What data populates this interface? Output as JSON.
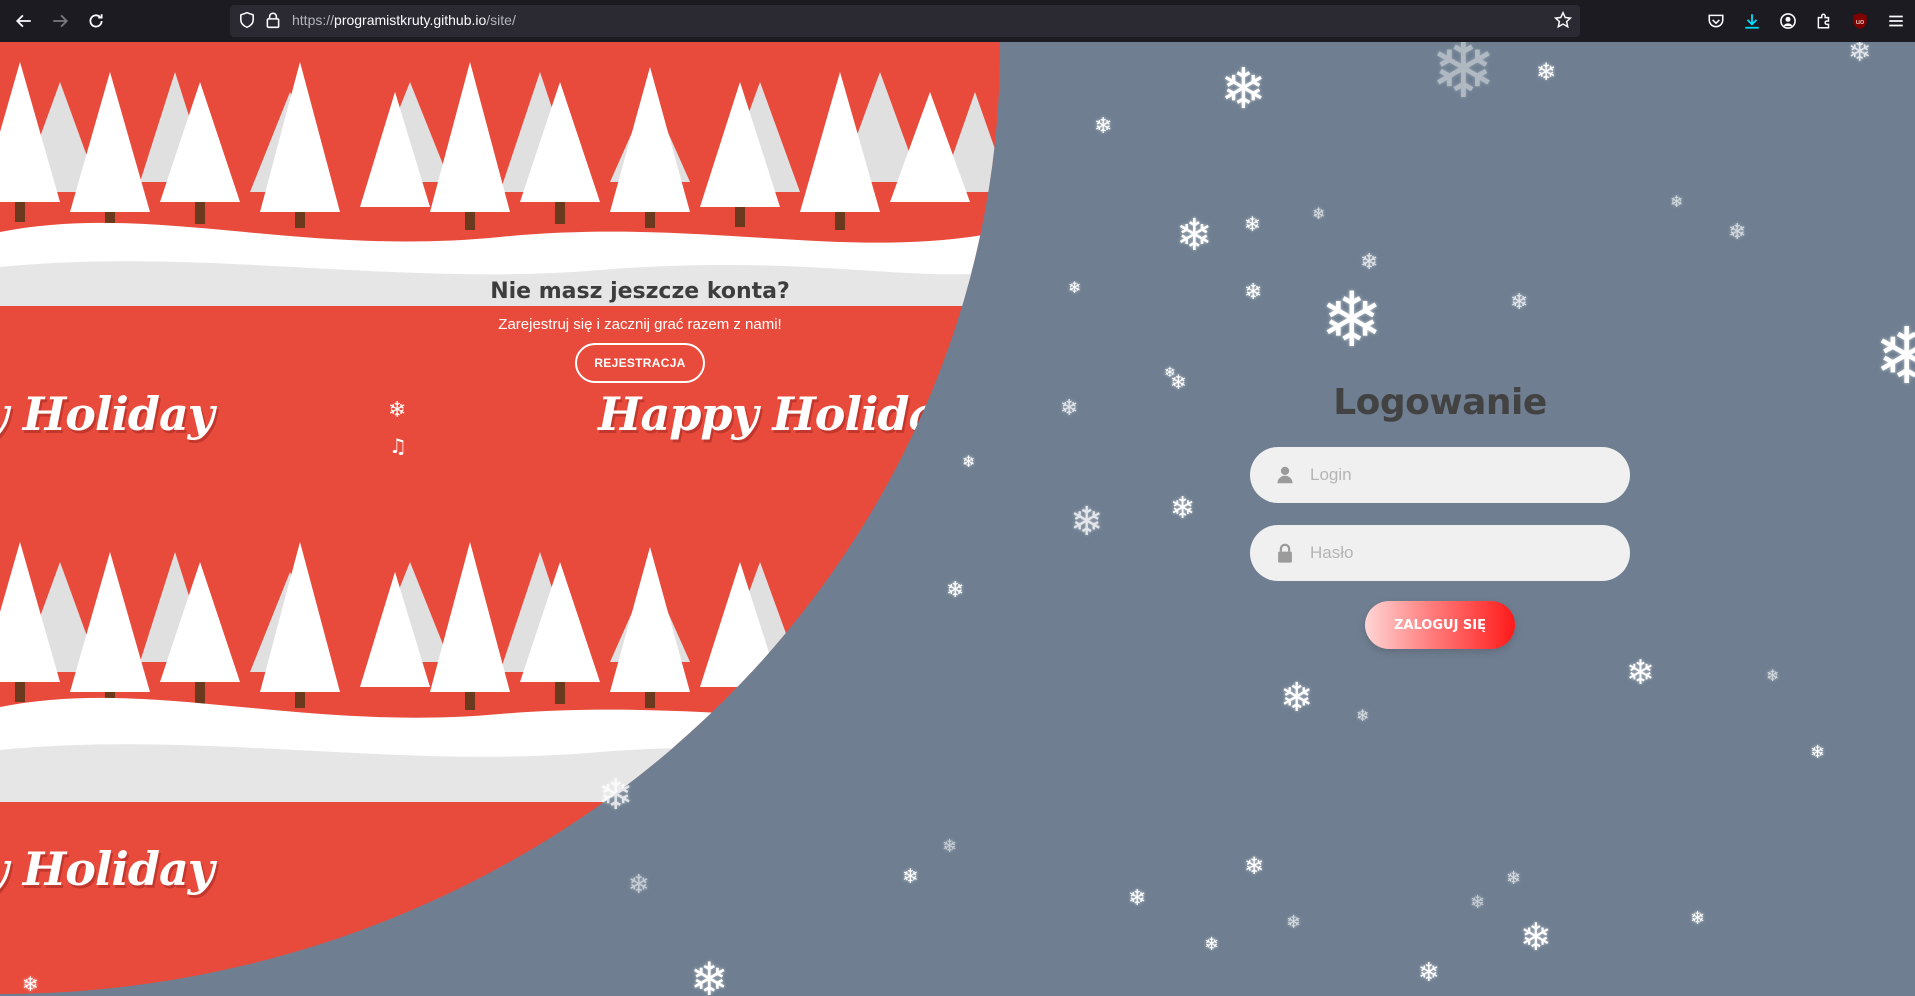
{
  "browser": {
    "url_prefix": "https://",
    "url_host": "programistkruty.github.io",
    "url_path": "/site/"
  },
  "signup": {
    "heading": "Nie masz jeszcze konta?",
    "text": "Zarejestruj się i zacznij grać razem z nami!",
    "button": "REJESTRACJA"
  },
  "banner": {
    "holiday_text_1": "y Holiday",
    "holiday_text_2": "Happy Holiday",
    "holiday_text_3": "y Holiday"
  },
  "login": {
    "title": "Logowanie",
    "login_placeholder": "Login",
    "password_placeholder": "Hasło",
    "submit": "ZALOGUJ SIĘ"
  },
  "icons": {
    "snowflake_toggle": "snowflake-icon",
    "music_toggle": "music-note-icon"
  },
  "colors": {
    "page_bg": "#6f7f91",
    "red_panel": "#e84b3c",
    "accent_gradient_end": "#ff1a1a"
  }
}
